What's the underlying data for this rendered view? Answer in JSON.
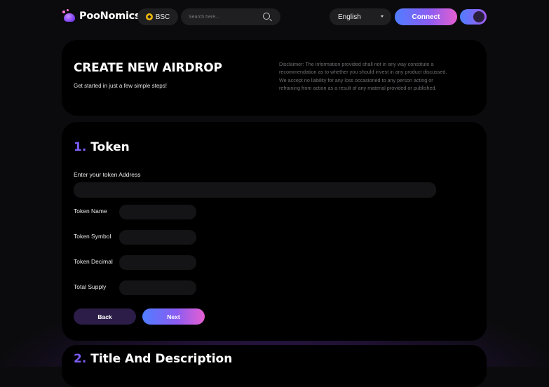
{
  "header": {
    "brand": "PooNomics",
    "chain": "BSC",
    "search_placeholder": "Search here...",
    "language": "English",
    "connect_label": "Connect"
  },
  "intro": {
    "title": "CREATE NEW AIRDROP",
    "subtitle": "Get started in just a few simple steps!",
    "disclaimer": "Disclaimer: The information provided shall not in any way constitute a recommendation as to whether you should invest in any product discussed. We accept no liability for any loss occasioned to any person acting or refraining from action as a result of any material provided or published."
  },
  "token_step": {
    "number": "1.",
    "title": "Token",
    "address_label": "Enter your token Address",
    "fields": {
      "name": "Token Name",
      "symbol": "Token Symbol",
      "decimal": "Token Decimal",
      "supply": "Total Supply"
    },
    "back_label": "Back",
    "next_label": "Next"
  },
  "title_step": {
    "number": "2.",
    "title": "Title And Description"
  },
  "colors": {
    "accent_blue": "#4f7dff",
    "accent_purple": "#8c5cf2",
    "accent_pink": "#e55fd0",
    "step_number": "#7d5df6"
  }
}
